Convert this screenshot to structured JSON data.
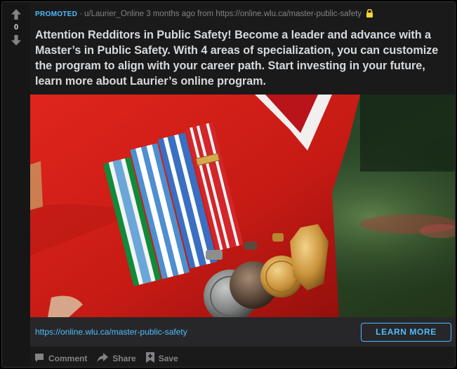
{
  "vote": {
    "score": "0",
    "upvote_icon": "arrow-up-icon",
    "downvote_icon": "arrow-down-icon"
  },
  "meta": {
    "promoted": "PROMOTED",
    "separator": "·",
    "byline": "u/Laurier_Online 3 months ago from https://online.wlu.ca/master-public-safety",
    "lock_icon": "lock-icon",
    "lock_color": "#ffd635"
  },
  "post": {
    "title": "Attention Redditors in Public Safety! Become a leader and advance with a Master’s in Public Safety. With 4 areas of specialization, you can customize the program to align with your career path. Start investing in your future, learn more about Laurier’s online program."
  },
  "image": {
    "subject": "medals-on-red-uniform"
  },
  "cta": {
    "link": "https://online.wlu.ca/master-public-safety",
    "button_label": "LEARN MORE",
    "accent": "#4fbcff"
  },
  "actions": {
    "comment_label": "Comment",
    "share_label": "Share",
    "save_label": "Save"
  }
}
